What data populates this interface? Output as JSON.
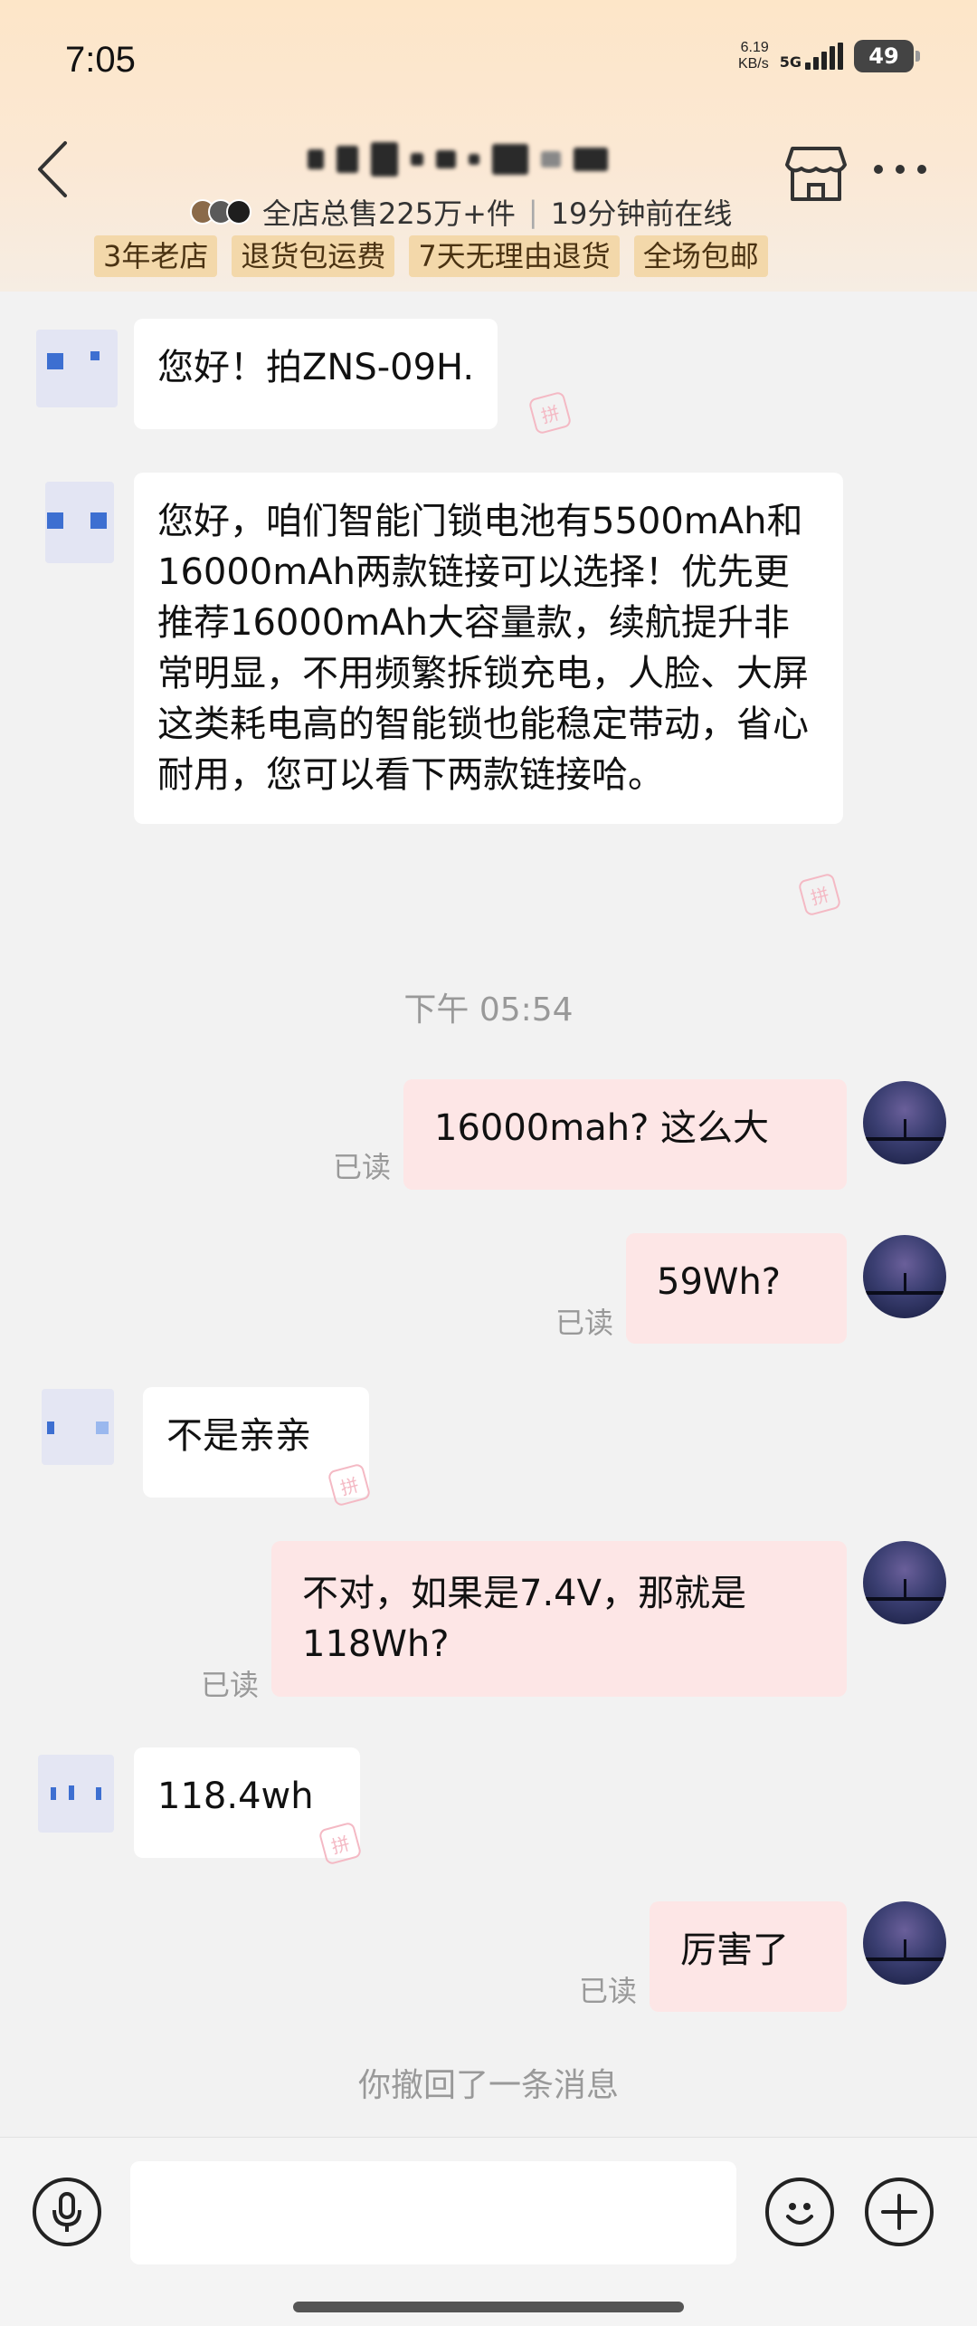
{
  "status_bar": {
    "time": "7:05",
    "net_speed_value": "6.19",
    "net_speed_unit": "KB/s",
    "network": "5G",
    "battery": "49"
  },
  "header": {
    "shop_stats": "全店总售225万+件",
    "online_status": "19分钟前在线",
    "meta_separator": "|",
    "tags": [
      "3年老店",
      "退货包运费",
      "7天无理由退货",
      "全场包邮"
    ]
  },
  "messages": {
    "m1": "您好！拍ZNS-09H.",
    "m2": "您好，咱们智能门锁电池有5500mAh和16000mAh两款链接可以选择！优先更推荐16000mAh大容量款，续航提升非常明显，不用频繁拆锁充电，人脸、大屏这类耗电高的智能锁也能稳定带动，省心耐用，您可以看下两款链接哈。",
    "timestamp": "下午 05:54",
    "m3": "16000mah? 这么大",
    "m4": "59Wh?",
    "m5": "不是亲亲",
    "m6": "不对，如果是7.4V，那就是118Wh?",
    "m7": "118.4wh",
    "m8": "厉害了",
    "recall": "你撤回了一条消息",
    "read_label": "已读",
    "stamp_label": "拼"
  },
  "colors": {
    "header_top": "#fde6c8",
    "tag_bg": "#f3d8aa",
    "sent_bubble": "#fde6e6",
    "received_bubble": "#ffffff",
    "page_bg": "#f2f2f2"
  },
  "icons": [
    "back-arrow-icon",
    "shop-icon",
    "more-icon",
    "mic-icon",
    "emoji-icon",
    "plus-icon"
  ]
}
